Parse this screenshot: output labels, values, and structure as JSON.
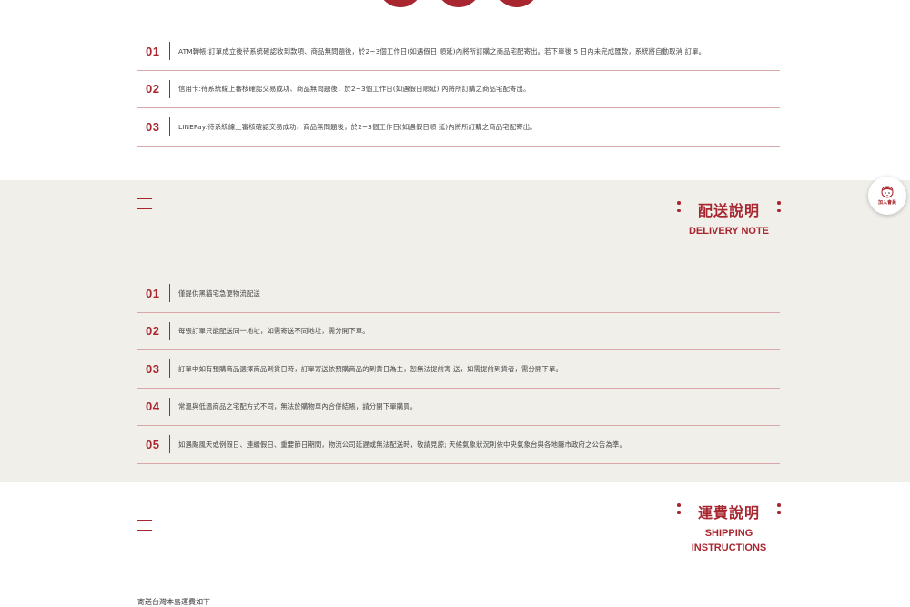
{
  "payment": {
    "items": [
      {
        "num": "01",
        "text": "ATM轉帳:訂單成立後待系統確認收到款項、商品無問題後，於2~3個工作日(如遇假日 順延)內將所訂購之商品宅配寄出。若下單後 5 日內未完成匯款，系統將自動取消 訂單。"
      },
      {
        "num": "02",
        "text": "信用卡:待系統線上審核確認交易成功、商品無問題後，於2~3個工作日(如遇假日順延) 內將所訂購之商品宅配寄出。"
      },
      {
        "num": "03",
        "text": "LINEPay:待系統線上審核確認交易成功、商品無問題後，於2~3個工作日(如遇假日順 延)內將所訂購之商品宅配寄出。"
      }
    ]
  },
  "delivery": {
    "title_zh": "配送說明",
    "title_en": "DELIVERY NOTE",
    "items": [
      {
        "num": "01",
        "text": "僅提供黑貓宅急便物流配送"
      },
      {
        "num": "02",
        "text": "每張訂單只能配送同一地址，如需寄送不同地址，需分開下單。"
      },
      {
        "num": "03",
        "text": "訂單中如有預購商品選擇商品到貨日時，訂單寄送依預購商品的到貨日為主，恕無法提前寄 送，如需提前到貨者，需分開下單。"
      },
      {
        "num": "04",
        "text": "常溫與低溫商品之宅配方式不同，無法於購物車內合併結帳，請分開下單購買。"
      },
      {
        "num": "05",
        "text": "如遇颱風天或例假日、連續假日、重要節日期間，物流公司延遲或無法配送時，敬請見諒; 天候氣象狀況則依中央氣象台與各地縣市政府之公告為準。"
      }
    ]
  },
  "shipping": {
    "title_zh": "運費說明",
    "title_en_line1": "SHIPPING",
    "title_en_line2": "INSTRUCTIONS",
    "note": "寄送台灣本島運費如下"
  },
  "badge": {
    "label": "加入會員",
    "icon": "mascot-girl-icon"
  },
  "colors": {
    "accent": "#a8262f",
    "section_bg": "#f0efea",
    "divider": "#d7a7aa"
  }
}
